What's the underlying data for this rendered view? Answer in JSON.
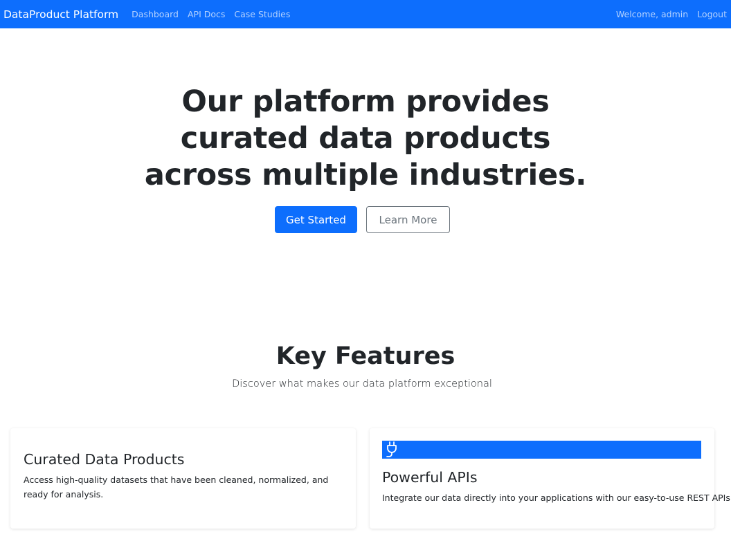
{
  "navbar": {
    "brand": "DataProduct Platform",
    "links": [
      "Dashboard",
      "API Docs",
      "Case Studies"
    ],
    "welcome": "Welcome, admin",
    "logout": "Logout",
    "background_color": "#0d6efd"
  },
  "hero": {
    "title": "Our platform provides curated data products across multiple industries.",
    "primary_button": "Get Started",
    "secondary_button": "Learn More"
  },
  "features": {
    "title": "Key Features",
    "subtitle": "Discover what makes our data platform exceptional",
    "cards": [
      {
        "title": "Curated Data Products",
        "text": "Access high-quality datasets that have been cleaned, normalized, and ready for analysis."
      },
      {
        "icon": "plug-icon",
        "title": "Powerful APIs",
        "text": "Integrate our data directly into your applications with our easy-to-use REST APIs."
      }
    ]
  }
}
